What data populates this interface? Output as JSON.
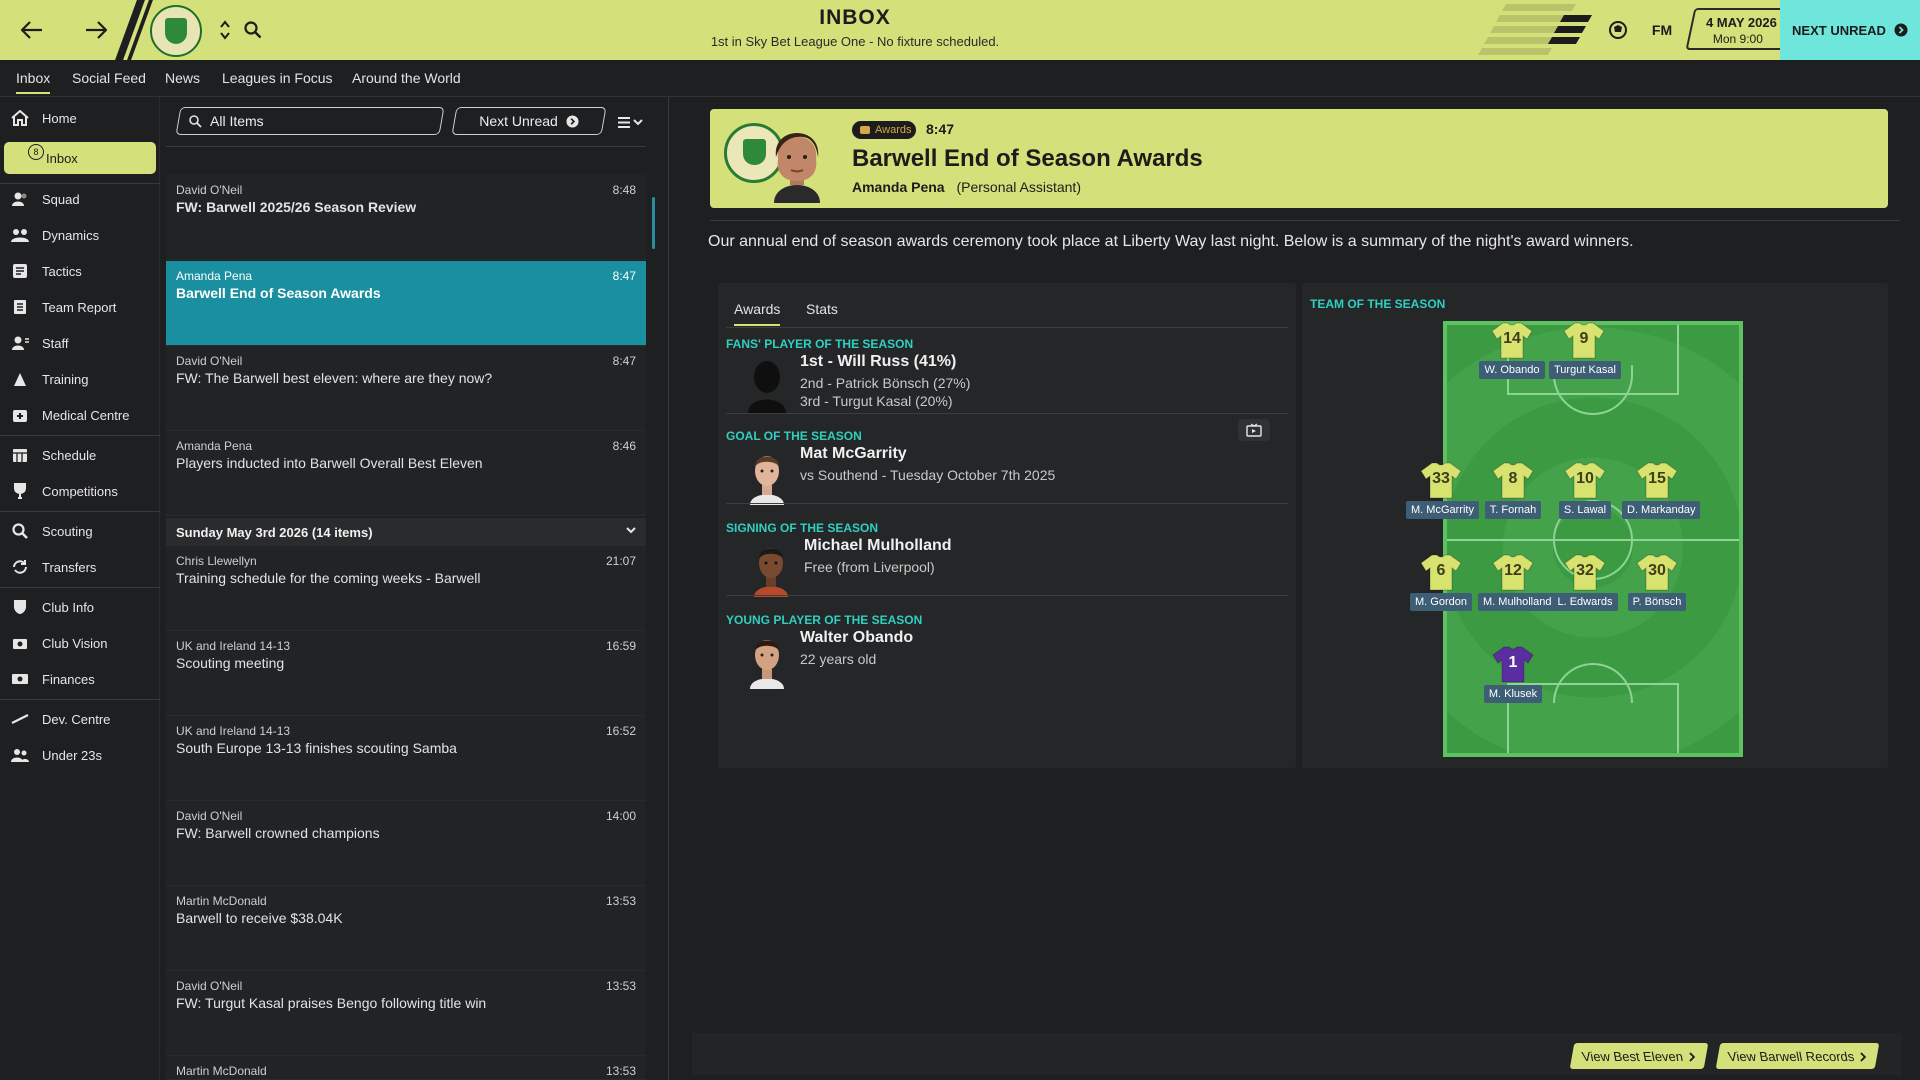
{
  "topbar": {
    "title": "INBOX",
    "subtitle": "1st in Sky Bet League One - No fixture scheduled.",
    "date": "4 MAY 2026",
    "time": "Mon 9:00",
    "next_unread": "NEXT UNREAD",
    "fm_label": "FM"
  },
  "tabs": [
    "Inbox",
    "Social Feed",
    "News",
    "Leagues in Focus",
    "Around the World"
  ],
  "sidebar": {
    "inbox_badge": "8",
    "items": [
      "Home",
      "Inbox",
      "Squad",
      "Dynamics",
      "Tactics",
      "Team Report",
      "Staff",
      "Training",
      "Medical Centre",
      "Schedule",
      "Competitions",
      "Scouting",
      "Transfers",
      "Club Info",
      "Club Vision",
      "Finances",
      "Dev. Centre",
      "Under 23s"
    ]
  },
  "list": {
    "search_placeholder": "All Items",
    "next_unread": "Next Unread",
    "messages_top": [
      {
        "from": "David O'Neil",
        "time": "8:48",
        "subject": "FW: Barwell 2025/26 Season Review"
      },
      {
        "from": "Amanda Pena",
        "time": "8:47",
        "subject": "Barwell End of Season Awards"
      },
      {
        "from": "David O'Neil",
        "time": "8:47",
        "subject": "FW: The Barwell best eleven: where are they now?"
      },
      {
        "from": "Amanda Pena",
        "time": "8:46",
        "subject": "Players inducted into Barwell Overall Best Eleven"
      }
    ],
    "day_header": "Sunday May 3rd 2026 (14 items)",
    "messages_day": [
      {
        "from": "Chris Llewellyn",
        "time": "21:07",
        "subject": "Training schedule for the coming weeks - Barwell"
      },
      {
        "from": "UK and Ireland 14-13",
        "time": "16:59",
        "subject": "Scouting meeting"
      },
      {
        "from": "UK and Ireland 14-13",
        "time": "16:52",
        "subject": "South Europe 13-13 finishes scouting Samba"
      },
      {
        "from": "David O'Neil",
        "time": "14:00",
        "subject": "FW: Barwell crowned champions"
      },
      {
        "from": "Martin McDonald",
        "time": "13:53",
        "subject": "Barwell to receive $38.04K"
      },
      {
        "from": "David O'Neil",
        "time": "13:53",
        "subject": "FW: Turgut Kasal praises Bengo following title win"
      },
      {
        "from": "Martin McDonald",
        "time": "13:53",
        "subject": ""
      }
    ]
  },
  "message": {
    "tag": "Awards",
    "time": "8:47",
    "title": "Barwell End of Season Awards",
    "sender": "Amanda Pena",
    "sender_role": "(Personal Assistant)",
    "body": "Our annual end of season awards ceremony took place at Liberty Way last night. Below is a summary of the night's award winners.",
    "tabs": [
      "Awards",
      "Stats"
    ],
    "awards": [
      {
        "caption": "FANS' PLAYER OF THE SEASON",
        "name": "1st - Will Russ (41%)",
        "lines": [
          "2nd - Patrick Bönsch (27%)",
          "3rd - Turgut Kasal (20%)"
        ]
      },
      {
        "caption": "GOAL OF THE SEASON",
        "name": "Mat McGarrity",
        "lines": [
          "vs Southend - Tuesday October 7th 2025"
        ]
      },
      {
        "caption": "SIGNING OF THE SEASON",
        "name": "Michael Mulholland",
        "lines": [
          "Free (from Liverpool)"
        ]
      },
      {
        "caption": "YOUNG PLAYER OF THE SEASON",
        "name": "Walter Obando",
        "lines": [
          "22 years old"
        ]
      }
    ],
    "team_label": "TEAM OF THE SEASON",
    "team": [
      {
        "num": "14",
        "name": "W. Obando"
      },
      {
        "num": "9",
        "name": "Turgut Kasal"
      },
      {
        "num": "33",
        "name": "M. McGarrity"
      },
      {
        "num": "8",
        "name": "T. Fornah"
      },
      {
        "num": "10",
        "name": "S. Lawal"
      },
      {
        "num": "15",
        "name": "D. Markanday"
      },
      {
        "num": "6",
        "name": "M. Gordon"
      },
      {
        "num": "12",
        "name": "M. Mulholland"
      },
      {
        "num": "32",
        "name": "L. Edwards"
      },
      {
        "num": "30",
        "name": "P. Bönsch"
      },
      {
        "num": "1",
        "name": "M. Klusek"
      }
    ],
    "footer_buttons": [
      "View Best Eleven",
      "View Barwell Records"
    ]
  },
  "colors": {
    "accent": "#d4e07a",
    "selected": "#1a8fa0",
    "teal_caption": "#2fd0c0",
    "next_unread": "#6ee6dc"
  }
}
